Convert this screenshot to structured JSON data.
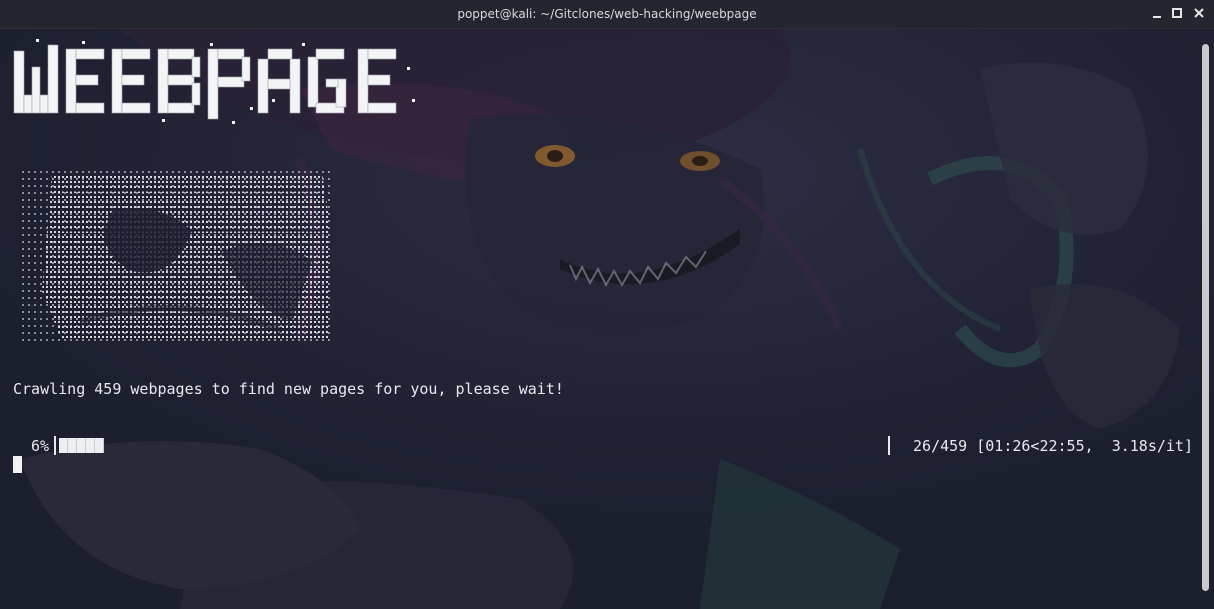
{
  "window": {
    "title": "poppet@kali: ~/Gitclones/web-hacking/weebpage"
  },
  "icons": {
    "minimize": "minimize-icon",
    "maximize": "maximize-icon",
    "close": "close-icon"
  },
  "terminal": {
    "banner_text": "WEEBPAGE",
    "message": "Crawling 459 webpages to find new pages for you, please wait!",
    "progress": {
      "percent_label": "6%",
      "fraction": 0.06,
      "stats": " 26/459 [01:26<22:55,  3.18s/it]"
    }
  },
  "colors": {
    "background": "#1d2030",
    "text": "#e8e9ee",
    "titlebar": "#23262f"
  }
}
